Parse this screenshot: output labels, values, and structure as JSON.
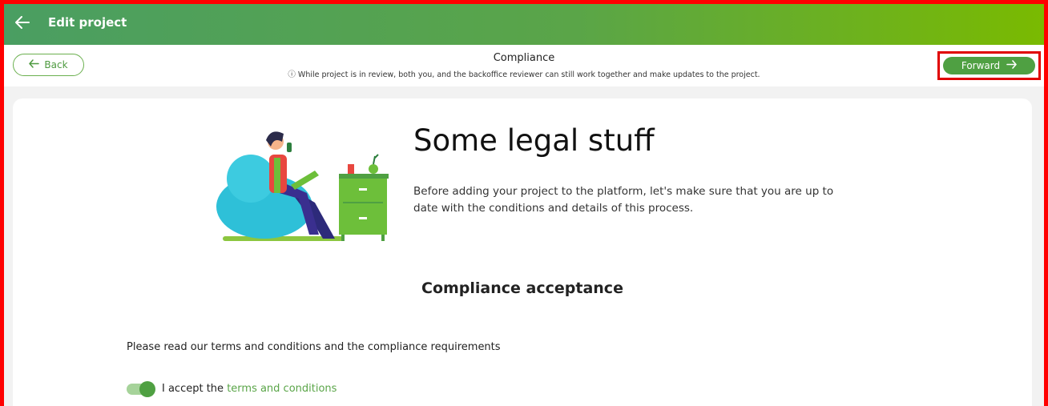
{
  "appbar": {
    "title": "Edit project",
    "back_icon": "arrow-left-icon"
  },
  "subbar": {
    "back_label": "Back",
    "heading": "Compliance",
    "note": "ⓘ While project is in review, both you, and the backoffice reviewer can still work together and make updates to the project.",
    "forward_label": "Forward"
  },
  "hero": {
    "title": "Some legal stuff",
    "description": "Before adding your project to the platform, let's make sure that you are up to date with the conditions and details of this process."
  },
  "compliance": {
    "section_title": "Compliance acceptance",
    "instruction": "Please read our terms and conditions and the compliance requirements",
    "accept_prefix": "I accept the ",
    "accept_link": "terms and conditions",
    "accepted": true
  },
  "colors": {
    "brand_green": "#4fa042",
    "header_gradient_end": "#7aba00",
    "highlight_red": "#e00000"
  }
}
